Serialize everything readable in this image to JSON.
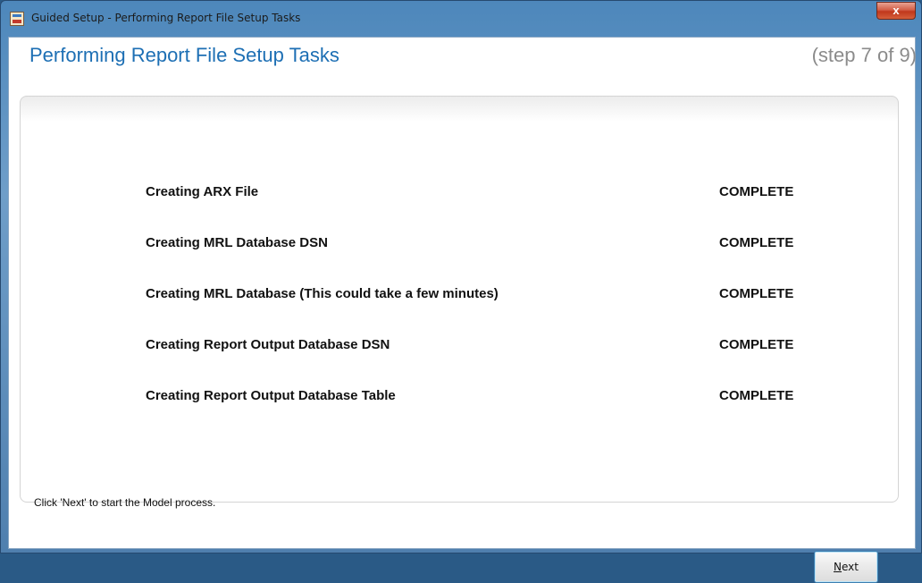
{
  "window": {
    "title": "Guided Setup - Performing Report File Setup Tasks",
    "close_label": "x"
  },
  "header": {
    "heading": "Performing Report File Setup Tasks",
    "step": "(step 7 of 9)"
  },
  "tasks": [
    {
      "label": "Creating ARX File",
      "status": "COMPLETE"
    },
    {
      "label": "Creating MRL Database DSN",
      "status": "COMPLETE"
    },
    {
      "label": "Creating MRL Database (This could take a few minutes)",
      "status": "COMPLETE"
    },
    {
      "label": "Creating Report Output Database DSN",
      "status": "COMPLETE"
    },
    {
      "label": "Creating Report Output Database Table",
      "status": "COMPLETE"
    }
  ],
  "footer": {
    "hint": "Click 'Next' to start the Model process.",
    "next_mnemonic": "N",
    "next_rest": "ext"
  },
  "colors": {
    "heading": "#1d6fb4",
    "step": "#8b8b8b",
    "titlebar": "#4d87bb"
  }
}
